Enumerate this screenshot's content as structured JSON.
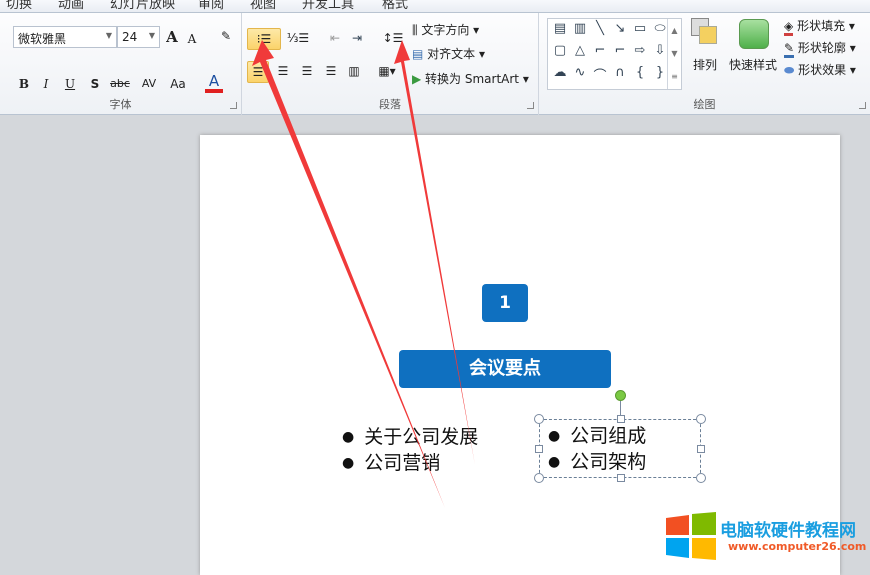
{
  "tabs": [
    "切换",
    "动画",
    "幻灯片放映",
    "审阅",
    "视图",
    "开发工具",
    "格式"
  ],
  "font_group": {
    "label": "字体",
    "font_name": "微软雅黑",
    "font_size": "24",
    "buttons": [
      "B",
      "I",
      "U",
      "S",
      "abc",
      "AV",
      "Aa",
      "A"
    ],
    "grow": "A",
    "shrink": "A",
    "font_color": "#e02020"
  },
  "paragraph_group": {
    "label": "段落",
    "text_direction": "文字方向",
    "align_text": "对齐文本",
    "smartart": "转换为 SmartArt",
    "bullets_active": true
  },
  "drawing_group": {
    "label": "绘图",
    "arrange": "排列",
    "quick_styles": "快速样式",
    "shape_fill": "形状填充",
    "shape_outline": "形状轮廓",
    "shape_effects": "形状效果"
  },
  "slide": {
    "number": "1",
    "title": "会议要点",
    "left_list": [
      "关于公司发展",
      "公司营销"
    ],
    "right_list": [
      "公司组成",
      "公司架构"
    ],
    "accent": "#0f70c0"
  },
  "annotation": {
    "arrow_color": "#f03a3a"
  },
  "watermark": {
    "title": "电脑软硬件教程网",
    "url": "www.computer26.com"
  }
}
